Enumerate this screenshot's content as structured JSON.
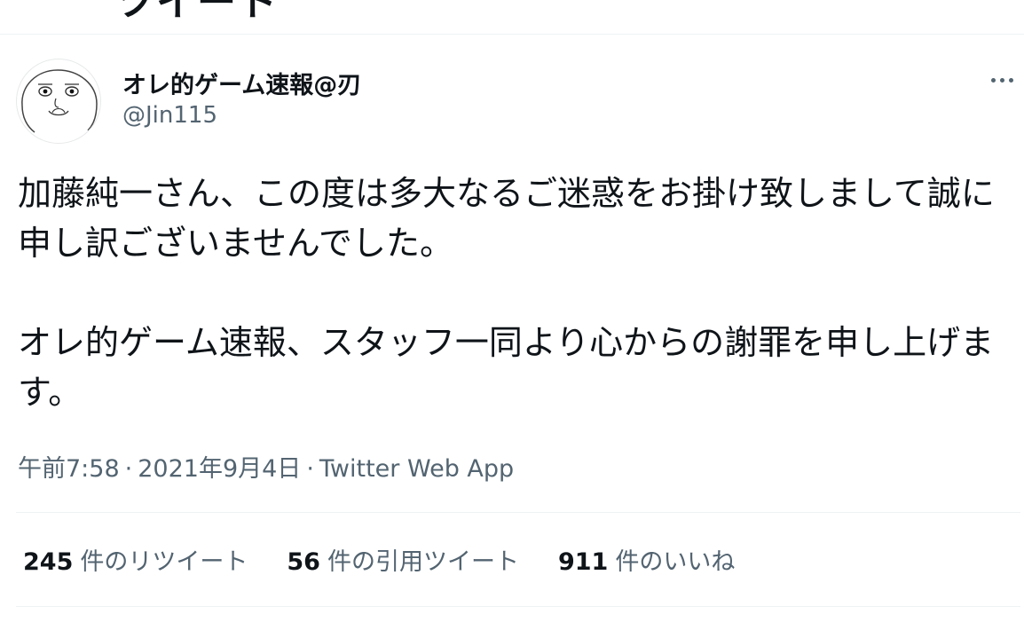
{
  "header": {
    "clipped_title": "ツイート"
  },
  "author": {
    "display_name": "オレ的ゲーム速報@刃",
    "handle": "@Jin115",
    "avatar_icon": "cartoon-face-avatar"
  },
  "tweet": {
    "paragraphs": [
      "加藤純一さん、この度は多大なるご迷惑をお掛け致しまして誠に申し訳ございませんでした。",
      "オレ的ゲーム速報、スタッフ一同より心からの謝罪を申し上げます。"
    ],
    "time": "午前7:58",
    "separator": "·",
    "date": "2021年9月4日",
    "source": "Twitter Web App"
  },
  "stats": {
    "retweets": {
      "count": "245",
      "label": "件のリツイート"
    },
    "quotes": {
      "count": "56",
      "label": "件の引用ツイート"
    },
    "likes": {
      "count": "911",
      "label": "件のいいね"
    }
  },
  "colors": {
    "text_primary": "#0f1419",
    "text_secondary": "#536471",
    "divider": "#eff3f4"
  }
}
